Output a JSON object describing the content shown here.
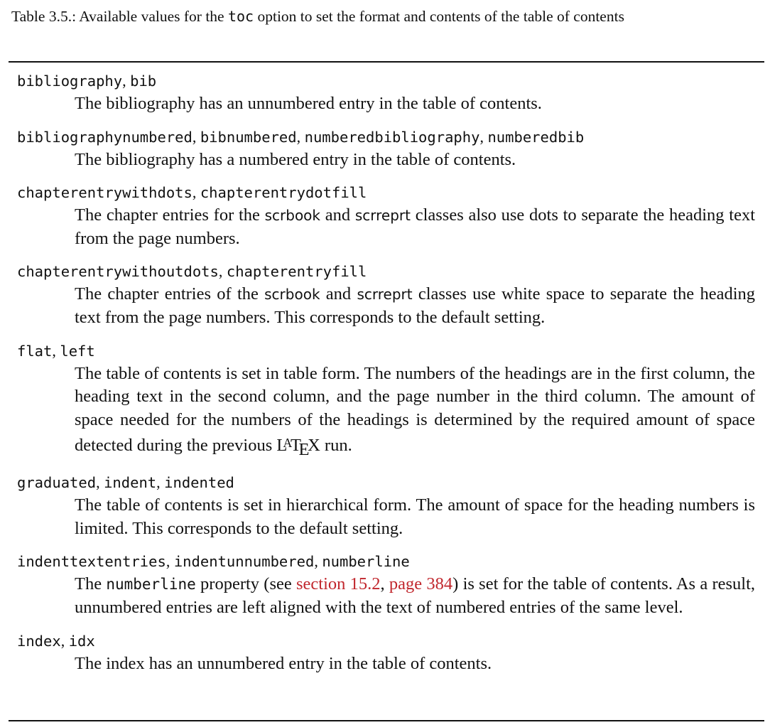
{
  "caption": {
    "prefix": "Table 3.5.: Available values for the ",
    "option": "toc",
    "suffix": " option to set the format and contents of the table of contents"
  },
  "entries": [
    {
      "keys": [
        "bibliography",
        "bib"
      ],
      "desc": [
        {
          "t": "The bibliography has an unnumbered entry in the table of contents."
        }
      ]
    },
    {
      "keys": [
        "bibliographynumbered",
        "bibnumbered",
        "numberedbibliography",
        "numberedbib"
      ],
      "desc": [
        {
          "t": "The bibliography has a numbered entry in the table of contents."
        }
      ]
    },
    {
      "keys": [
        "chapterentrywithdots",
        "chapterentrydotfill"
      ],
      "desc": [
        {
          "t": "The chapter entries for the "
        },
        {
          "t": "scrbook",
          "s": "sans"
        },
        {
          "t": " and "
        },
        {
          "t": "scrreprt",
          "s": "sans"
        },
        {
          "t": " classes also use dots to separate the heading text from the page numbers."
        }
      ]
    },
    {
      "keys": [
        "chapterentrywithoutdots",
        "chapterentryfill"
      ],
      "desc": [
        {
          "t": "The chapter entries of the "
        },
        {
          "t": "scrbook",
          "s": "sans"
        },
        {
          "t": " and "
        },
        {
          "t": "scrreprt",
          "s": "sans"
        },
        {
          "t": " classes use white space to separate the heading text from the page numbers. This corresponds to the default setting."
        }
      ]
    },
    {
      "keys": [
        "flat",
        "left"
      ],
      "desc": [
        {
          "t": "The table of contents is set in table form. The numbers of the headings are in the first column, the heading text in the second column, and the page number in the third column. The amount of space needed for the numbers of the headings is determined by the required amount of space detected during the previous "
        },
        {
          "t": "LaTeX",
          "s": "latex"
        },
        {
          "t": " run."
        }
      ]
    },
    {
      "keys": [
        "graduated",
        "indent",
        "indented"
      ],
      "desc": [
        {
          "t": "The table of contents is set in hierarchical form. The amount of space for the heading numbers is limited. This corresponds to the default setting."
        }
      ]
    },
    {
      "keys": [
        "indenttextentries",
        "indentunnumbered",
        "numberline"
      ],
      "desc": [
        {
          "t": "The "
        },
        {
          "t": "numberline",
          "s": "mono"
        },
        {
          "t": " property (see "
        },
        {
          "t": "section 15.2",
          "s": "link"
        },
        {
          "t": ", "
        },
        {
          "t": "page 384",
          "s": "link"
        },
        {
          "t": ") is set for the table of contents. As a result, unnumbered entries are left aligned with the text of numbered entries of the same level."
        }
      ]
    },
    {
      "keys": [
        "index",
        "idx"
      ],
      "desc": [
        {
          "t": "The index has an unnumbered entry in the table of contents."
        }
      ]
    }
  ]
}
